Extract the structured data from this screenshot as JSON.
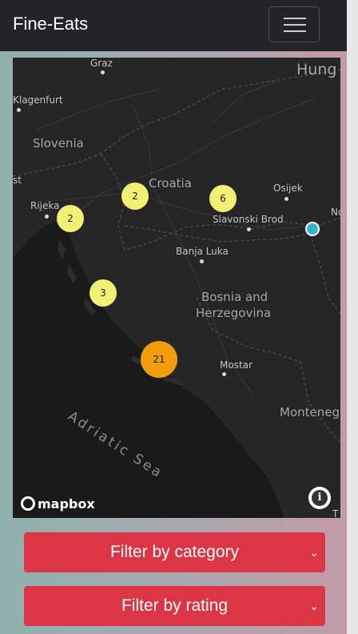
{
  "navbar": {
    "brand": "Fine-Eats",
    "toggle_icon": "hamburger-menu-icon"
  },
  "map": {
    "style": "dark",
    "places": [
      {
        "id": "graz",
        "label": "Graz"
      },
      {
        "id": "hung",
        "label": "Hung"
      },
      {
        "id": "klagenfurt",
        "label": "Klagenfurt"
      },
      {
        "id": "slovenia",
        "label": "Slovenia"
      },
      {
        "id": "st",
        "label": "st"
      },
      {
        "id": "croatia",
        "label": "Croatia"
      },
      {
        "id": "osijek",
        "label": "Osijek"
      },
      {
        "id": "rijeka",
        "label": "Rijeka"
      },
      {
        "id": "no",
        "label": "No"
      },
      {
        "id": "slavonski",
        "label": "Slavonski Brod"
      },
      {
        "id": "banja",
        "label": "Banja Luka"
      },
      {
        "id": "bosnia1",
        "label": "Bosnia and"
      },
      {
        "id": "bosnia2",
        "label": "Herzegovina"
      },
      {
        "id": "mostar",
        "label": "Mostar"
      },
      {
        "id": "monteneg",
        "label": "Monteneg"
      },
      {
        "id": "t",
        "label": "T"
      }
    ],
    "sea_label": "Adriatic Sea",
    "clusters": [
      {
        "id": "c1",
        "count": "2",
        "color": "#f1f075"
      },
      {
        "id": "c2",
        "count": "6",
        "color": "#f1f075"
      },
      {
        "id": "c3",
        "count": "2",
        "color": "#f1f075"
      },
      {
        "id": "c4",
        "count": "3",
        "color": "#f1f075"
      },
      {
        "id": "c5",
        "count": "21",
        "color": "#f29e0c"
      }
    ],
    "marker_color": "#3bb2d0",
    "attribution_logo": "mapbox",
    "info_icon": "info-icon"
  },
  "filters": {
    "category_label": "Filter by category",
    "rating_label": "Filter by rating",
    "accent_color": "#dc3545"
  }
}
